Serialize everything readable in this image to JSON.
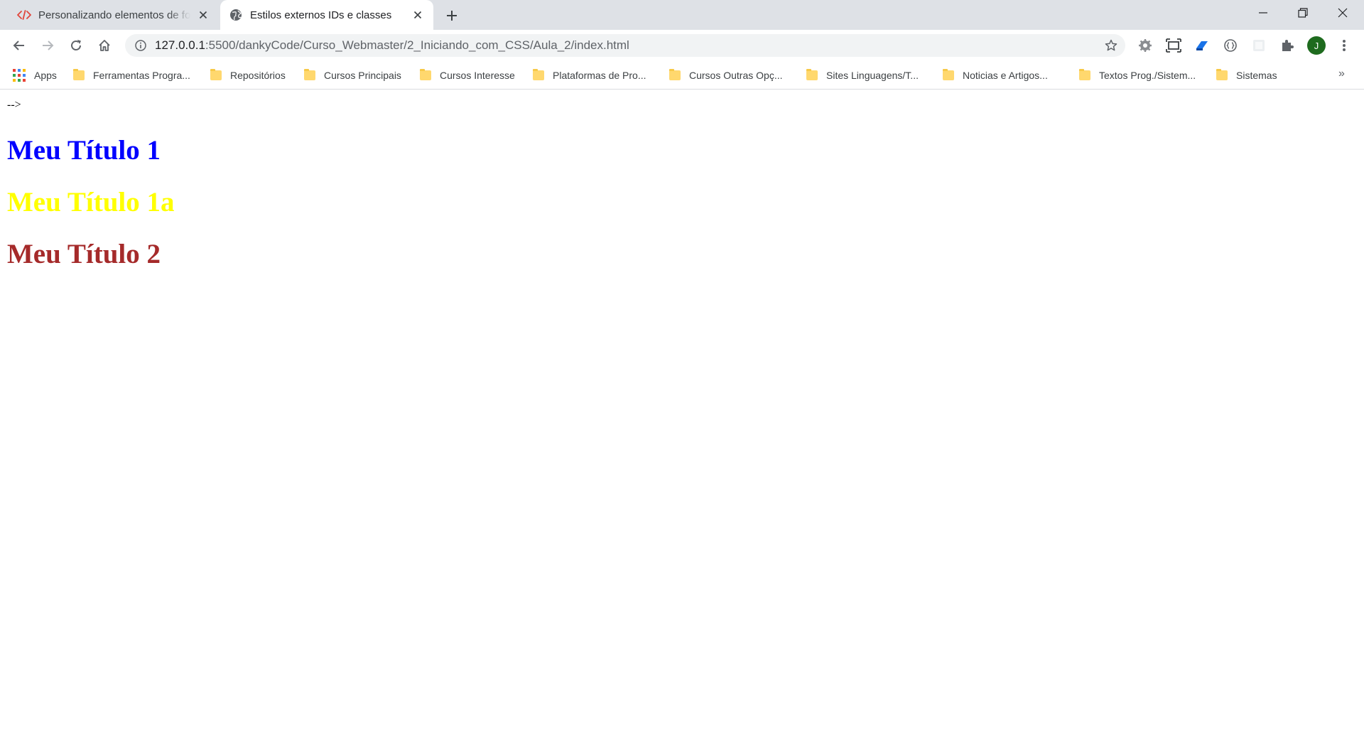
{
  "browser": {
    "tabs": [
      {
        "title": "Personalizando elementos de for",
        "icon": "code-icon",
        "active": false
      },
      {
        "title": "Estilos externos IDs e classes",
        "icon": "globe-icon",
        "active": true
      }
    ],
    "address_bar": {
      "host": "127.0.0.1",
      "path": ":5500/dankyCode/Curso_Webmaster/2_Iniciando_com_CSS/Aula_2/index.html"
    },
    "profile_initial": "J",
    "bookmarks": [
      {
        "label": "Apps",
        "icon": "apps-grid-icon"
      },
      {
        "label": "Ferramentas Progra...",
        "icon": "folder-icon"
      },
      {
        "label": "Repositórios",
        "icon": "folder-icon"
      },
      {
        "label": "Cursos Principais",
        "icon": "folder-icon"
      },
      {
        "label": "Cursos Interesse",
        "icon": "folder-icon"
      },
      {
        "label": "Plataformas de Pro...",
        "icon": "folder-icon"
      },
      {
        "label": "Cursos Outras Opç...",
        "icon": "folder-icon"
      },
      {
        "label": "Sites Linguagens/T...",
        "icon": "folder-icon"
      },
      {
        "label": "Noticias e Artigos...",
        "icon": "folder-icon"
      },
      {
        "label": "Textos Prog./Sistem...",
        "icon": "folder-icon"
      },
      {
        "label": "Sistemas",
        "icon": "folder-icon"
      }
    ],
    "bookmarks_overflow": "»"
  },
  "page": {
    "stray_text": "-->",
    "headings": [
      {
        "text": "Meu Título 1",
        "color": "#0000ff"
      },
      {
        "text": "Meu Título 1a",
        "color": "#ffff00"
      },
      {
        "text": "Meu Título 2",
        "color": "#a52a2a"
      }
    ]
  }
}
